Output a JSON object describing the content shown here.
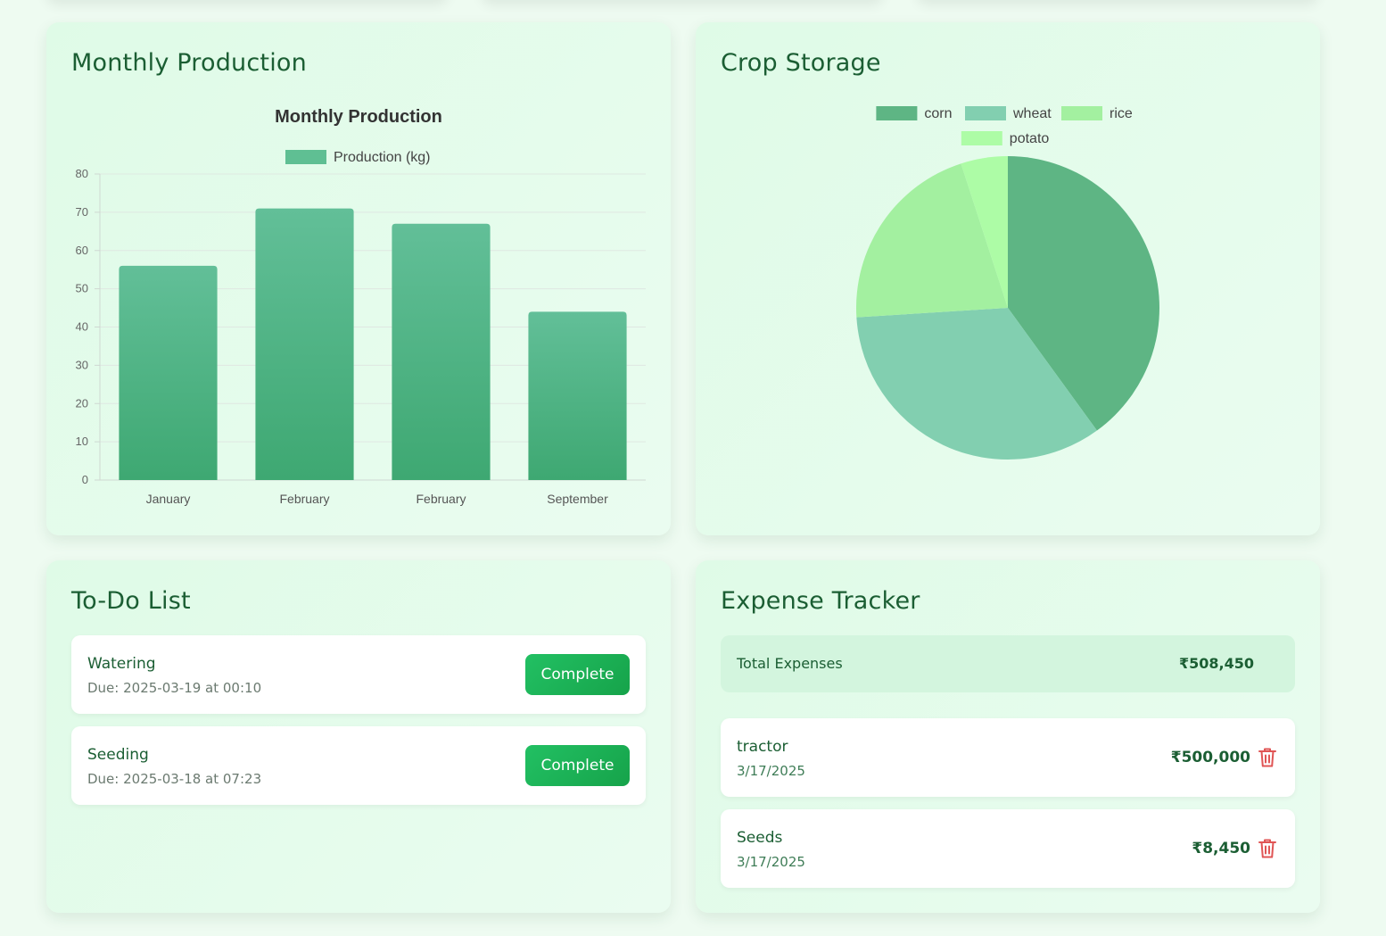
{
  "production": {
    "card_title": "Monthly Production",
    "chart_data": {
      "type": "bar",
      "title": "Monthly Production",
      "categories": [
        "January",
        "February",
        "February",
        "September"
      ],
      "series": [
        {
          "name": "Production (kg)",
          "values": [
            56,
            71,
            67,
            44
          ]
        }
      ],
      "ylim": [
        0,
        80
      ],
      "yticks": [
        0,
        10,
        20,
        30,
        40,
        50,
        60,
        70,
        80
      ],
      "grid": true,
      "legend": "top",
      "color": "#3ea872"
    }
  },
  "storage": {
    "card_title": "Crop Storage",
    "chart_data": {
      "type": "pie",
      "labels": [
        "corn",
        "wheat",
        "rice",
        "potato"
      ],
      "values": [
        40,
        34,
        21,
        5
      ],
      "colors": [
        "#5eb584",
        "#82cfb0",
        "#a3f0a0",
        "#adfca6"
      ],
      "legend": "top"
    }
  },
  "todo": {
    "card_title": "To-Do List",
    "items": [
      {
        "name": "Watering",
        "due": "Due: 2025-03-19 at 00:10",
        "button": "Complete"
      },
      {
        "name": "Seeding",
        "due": "Due: 2025-03-18 at 07:23",
        "button": "Complete"
      }
    ]
  },
  "expense": {
    "card_title": "Expense Tracker",
    "total_label": "Total Expenses",
    "total_value": "₹508,450",
    "items": [
      {
        "name": "tractor",
        "date": "3/17/2025",
        "amount": "₹500,000",
        "icon": "trash-icon"
      },
      {
        "name": "Seeds",
        "date": "3/17/2025",
        "amount": "₹8,450",
        "icon": "trash-icon"
      }
    ]
  },
  "colors": {
    "accent": "#16a34a",
    "title": "#1b5e33",
    "delete": "#e05555"
  }
}
